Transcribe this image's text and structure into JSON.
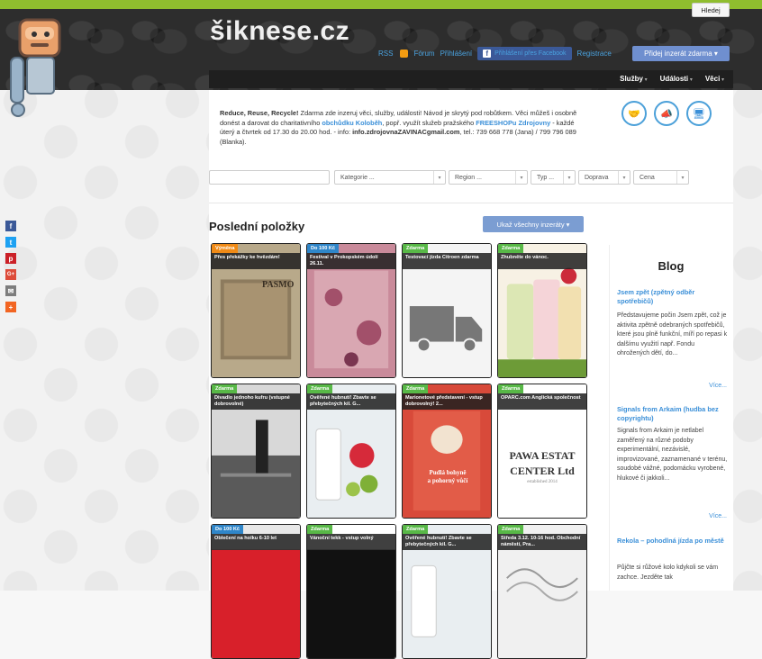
{
  "site": {
    "logo": "šiknese.cz",
    "colors": {
      "accent": "#8fbd2e",
      "link": "#3a8fd8",
      "button": "#6f8fcf",
      "facebook": "#3b5998"
    }
  },
  "toplinks": {
    "rss": "RSS",
    "forum": "Fórum",
    "login": "Přihlášení",
    "facebook_login": "Přihlášení přes Facebook",
    "register": "Registrace",
    "add_ad": "Přidej inzerát zdarma ▾"
  },
  "nav": {
    "items": [
      "Služby",
      "Události",
      "Věci"
    ]
  },
  "intro": {
    "lead": "Reduce, Reuse, Recycle!",
    "text1": " Zdarma zde inzeruj věci, služby, události! Návod je skrytý pod robůtkem. Věci můžeš i osobně donést a darovat do charitativního ",
    "shop_link": "obchůdku Koloběh",
    "text2": ", popř. využít služeb pražského ",
    "freeshop_link": "FREESHOPu Zdrojovny",
    "text3": " - každé úterý a čtvrtek od 17.30 do 20.00 hod. - info: ",
    "email": "info.zdrojovnaZAVINACgmail.com",
    "text4": ", tel.: 739 668 778 (Jana) / 799 796 089 (Blanka)."
  },
  "category_icons": [
    "handshake-icon",
    "megaphone-icon",
    "monitor-icon"
  ],
  "search": {
    "input_value": "",
    "kategorie": "Kategorie ...",
    "region": "Region ...",
    "typ": "Typ ...",
    "doprava": "Doprava",
    "cena": "Cena",
    "submit": "Hledej"
  },
  "latest": {
    "title": "Poslední položky",
    "show_all": "Ukaž všechny inzeráty ▾",
    "items": [
      {
        "tag": "Výměna",
        "tag_color": "orange",
        "caption": "Přes překážky ke hvězdám!"
      },
      {
        "tag": "Do 100 Kč",
        "tag_color": "blue",
        "caption": "Festival v Prokopském údolí 26.11."
      },
      {
        "tag": "Zdarma",
        "tag_color": "green",
        "caption": "Testovací jízda Citroen zdarma"
      },
      {
        "tag": "Zdarma",
        "tag_color": "green",
        "caption": "Zhubněte do vánoc."
      },
      {
        "tag": "Zdarma",
        "tag_color": "green",
        "caption": "Divadlo jednoho kufru (vstupné dobrovolné)"
      },
      {
        "tag": "Zdarma",
        "tag_color": "green",
        "caption": "Ověřené hubnutí! Zbavte se přebytečných kil. G..."
      },
      {
        "tag": "Zdarma",
        "tag_color": "green",
        "caption": "Marionetové představení - vstup dobrovolný! 2..."
      },
      {
        "tag": "Zdarma",
        "tag_color": "green",
        "caption": "OPARC.com Anglická společnost"
      },
      {
        "tag": "Do 100 Kč",
        "tag_color": "blue",
        "caption": "Oblečení na holku 6-10 let"
      },
      {
        "tag": "Zdarma",
        "tag_color": "green",
        "caption": "Vánoční tekk - vstup volný"
      },
      {
        "tag": "Zdarma",
        "tag_color": "green",
        "caption": "Ověřené hubnutí! Zbavte se přebytečných kil. G..."
      },
      {
        "tag": "Zdarma",
        "tag_color": "green",
        "caption": "Středa 3.12. 10-16 hod. Obchodní náměstí, Pra..."
      }
    ],
    "image_texts": {
      "pasmo": "PASMO",
      "opawa1": "PAWA ESTAT",
      "opawa2": "CENTER Ltd",
      "opawa3": "established 2014",
      "poster1": "Pudlá bohyně",
      "poster2": "a pohorný vůčí"
    }
  },
  "blog": {
    "title": "Blog",
    "posts": [
      {
        "title": "Jsem zpět (zpětný odběr spotřebičů)",
        "text": "Představujeme počin Jsem zpět, což je aktivita zpětně odebraných spotřebičů, které jsou plně funkční, míří po repasi k dalšímu využití např. Fondu ohrožených dětí, do...",
        "more": "Více..."
      },
      {
        "title": "Signals from Arkaim (hudba bez copyrightu)",
        "text": "Signals from Arkaim je netlabel zaměřený na různé podoby experimentální, nezávislé, improvizované, zaznamenané v terénu, soudobé vážné, podomácku vyrobené, hlukové či jakkoli...",
        "more": "Více..."
      },
      {
        "title": "Rekola – pohodlná jízda po městě",
        "text": "Půjčte si růžové kolo kdykoli se vám zachce. Jezděte tak",
        "more": ""
      }
    ]
  },
  "social": [
    {
      "icon": "facebook-icon",
      "glyph": "f",
      "color": "#3b5998"
    },
    {
      "icon": "twitter-icon",
      "glyph": "t",
      "color": "#1da1f2"
    },
    {
      "icon": "pinterest-icon",
      "glyph": "p",
      "color": "#cb2027"
    },
    {
      "icon": "googleplus-icon",
      "glyph": "G+",
      "color": "#dd4b39"
    },
    {
      "icon": "email-icon",
      "glyph": "✉",
      "color": "#7d7d7d"
    },
    {
      "icon": "share-plus-icon",
      "glyph": "+",
      "color": "#f26522"
    }
  ]
}
